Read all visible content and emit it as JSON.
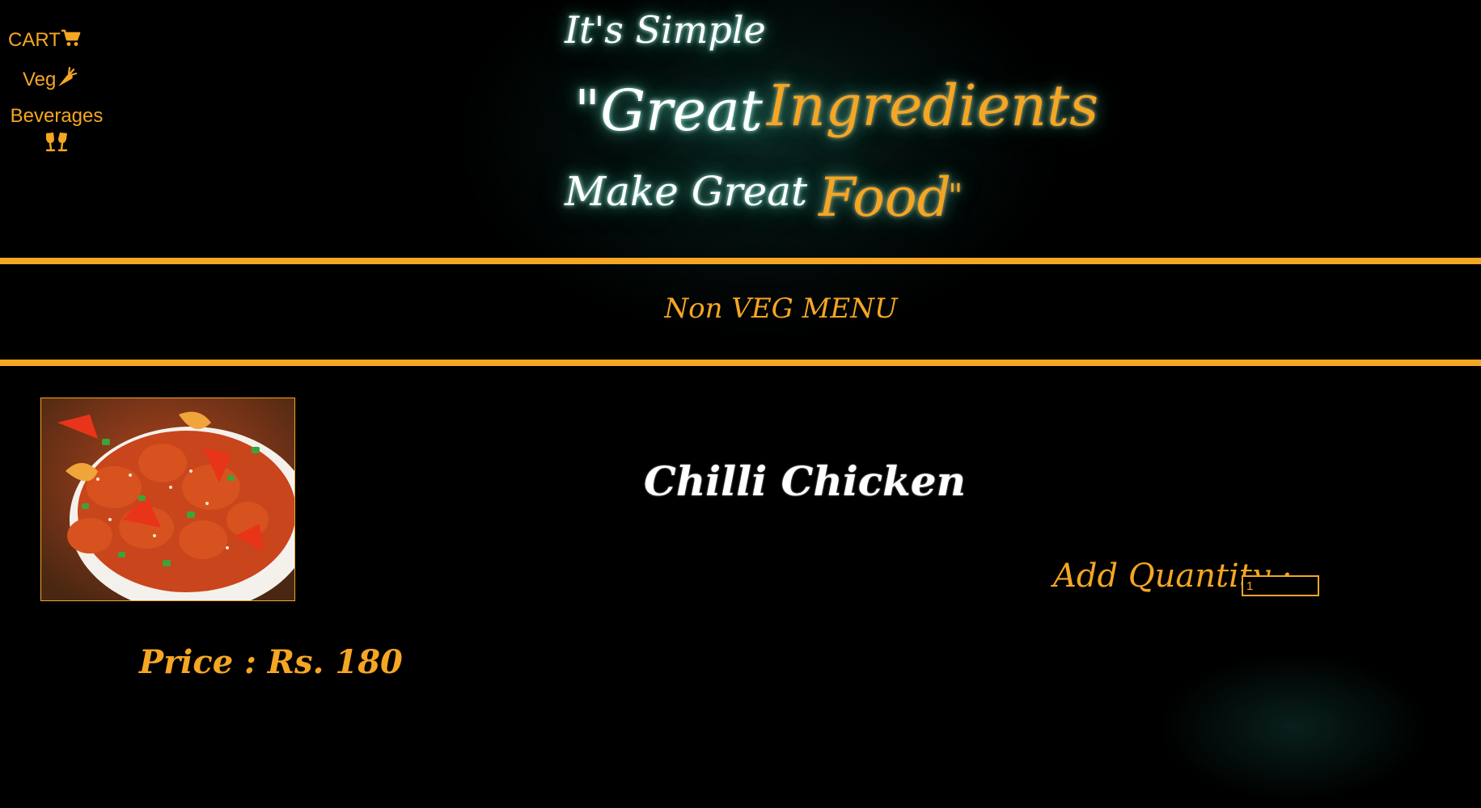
{
  "nav": {
    "cart_label": "CART",
    "cart_icon": "shopping-cart-icon",
    "veg_label": "Veg",
    "veg_icon": "carrot-icon",
    "beverages_label": "Beverages",
    "beverages_icon": "cheers-glasses-icon"
  },
  "hero": {
    "line1": "It's Simple",
    "line2_white": "\"Great",
    "line2_orange": "Ingredients",
    "line3_white": "Make Great",
    "line3_orange": "Food",
    "line3_quote": "\""
  },
  "menu": {
    "title": "Non VEG MENU"
  },
  "product": {
    "name": "Chilli Chicken",
    "image_alt": "Chilli Chicken dish",
    "quantity_label": "Add Quantity :",
    "quantity_value": "1",
    "price_label": "Price : Rs. 180"
  },
  "colors": {
    "accent": "#f5a623",
    "background": "#000000",
    "glow": "#2a8f7a"
  }
}
